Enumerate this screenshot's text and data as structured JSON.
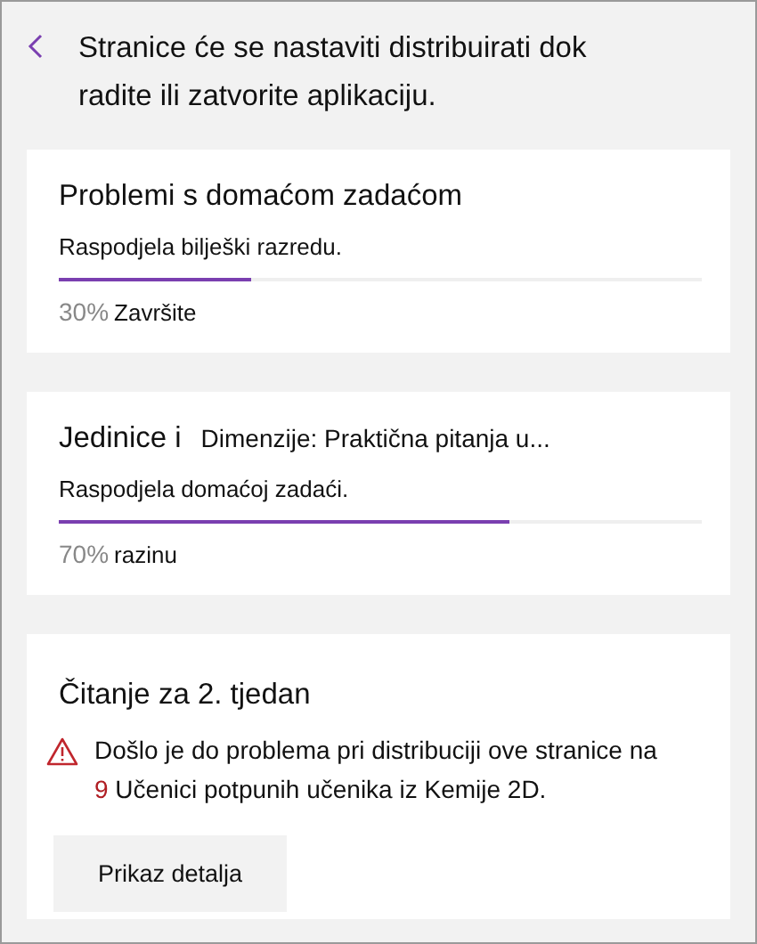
{
  "header": {
    "message": "Stranice će se nastaviti distribuirati dok radite ili zatvorite aplikaciju."
  },
  "cards": [
    {
      "kind": "progress",
      "title": "Problemi s domaćom zadaćom",
      "subtitle": "Raspodjela bilješki razredu.",
      "level": 0.3,
      "percent": "30%",
      "status": "Završite"
    },
    {
      "kind": "progress",
      "title": "Jedinice i",
      "title_extra": "Dimenzije: Praktična pitanja u...",
      "subtitle": "Raspodjela domaćoj zadaći.",
      "level": 0.7,
      "percent": "70%",
      "status": "razinu"
    },
    {
      "kind": "error",
      "title": "Čitanje za 2. tjedan",
      "message_start": "Došlo je do problema pri distribuciji ove stranice na",
      "count": "9",
      "message_end": "Učenici potpunih učenika iz Kemije 2D.",
      "button": "Prikaz detalja"
    }
  ]
}
